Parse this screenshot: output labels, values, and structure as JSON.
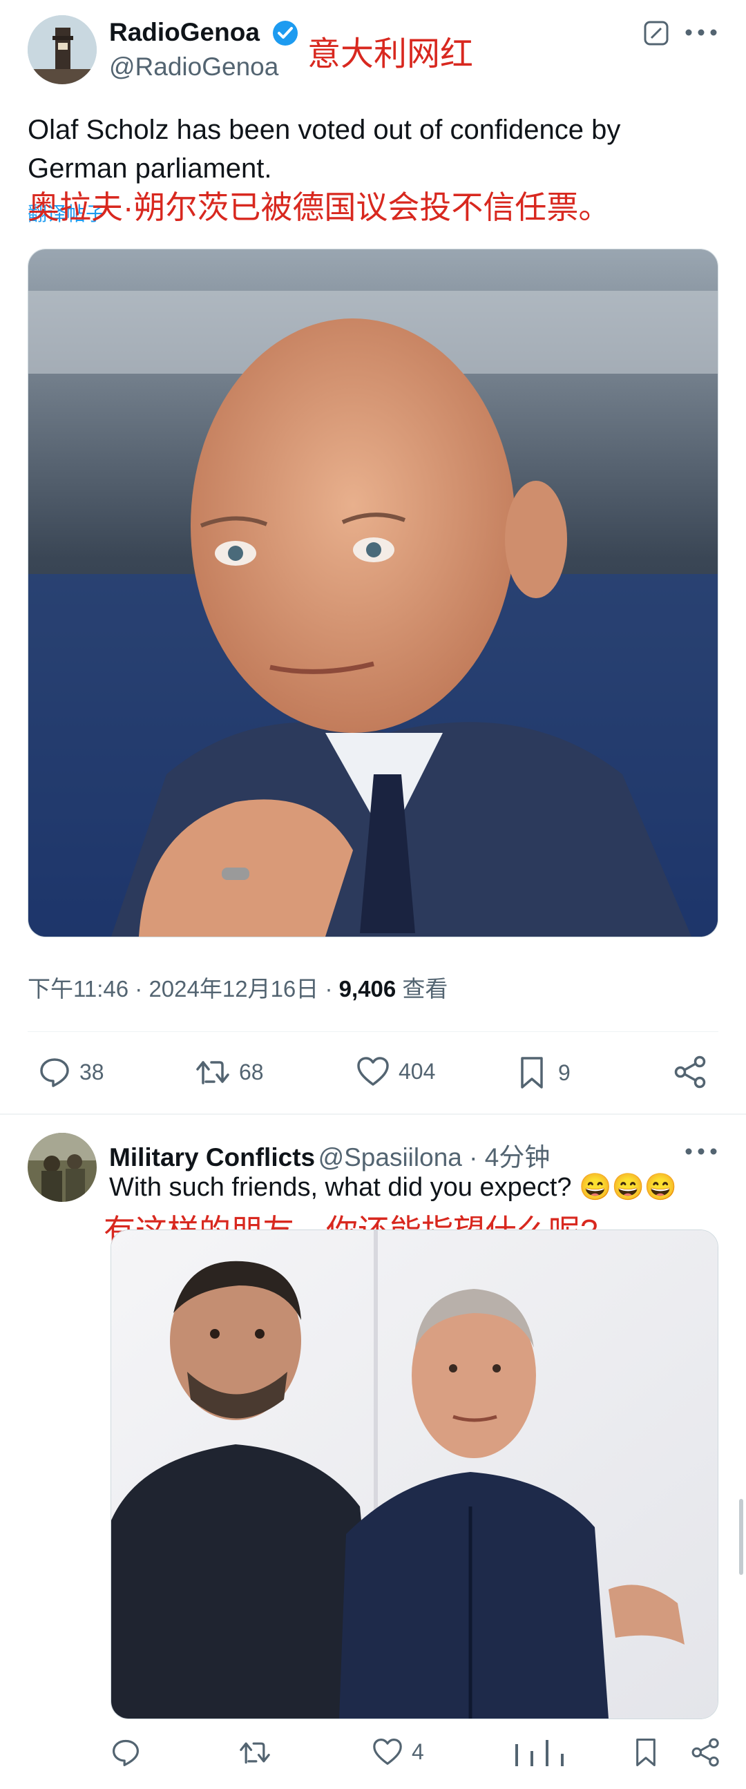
{
  "tweet1": {
    "display_name": "RadioGenoa",
    "handle": "@RadioGenoa",
    "annotation_label": "意大利网红",
    "text_line1": "Olaf Scholz has been voted out of confidence by",
    "text_line2": "German parliament.",
    "translate_link": "翻译帖子",
    "annotation_translation": "奥拉夫·朔尔茨已被德国议会投不信任票。",
    "meta_time": "下午11:46 · 2024年12月16日 · ",
    "meta_views": "9,406",
    "meta_views_label": " 查看",
    "actions": {
      "replies": "38",
      "retweets": "68",
      "likes": "404",
      "bookmarks": "9"
    }
  },
  "tweet2": {
    "display_name": "Military Conflicts",
    "handle": "@Spasiilona",
    "time": " · 4分钟",
    "text": "With such friends, what did you expect?",
    "emoji": "😄😄😄",
    "annotation_translation": "有这样的朋友，你还能指望什么呢?",
    "actions": {
      "likes": "4"
    }
  },
  "colors": {
    "verified": "#1d9bf0",
    "annotation": "#d8281f",
    "muted": "#536471"
  },
  "icons": [
    "edit-icon",
    "more-icon",
    "verified-badge-icon",
    "reply-icon",
    "retweet-icon",
    "like-icon",
    "bookmark-icon",
    "share-icon"
  ]
}
